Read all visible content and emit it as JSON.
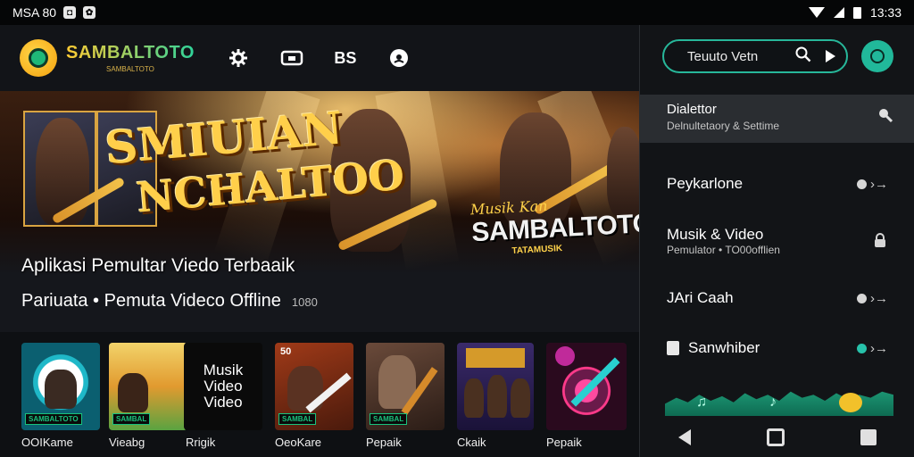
{
  "status_bar": {
    "carrier": "MSA 80",
    "time": "13:33"
  },
  "app_bar": {
    "brand_name": "SAMBALTOTO",
    "brand_tagline": "SAMBALTOTO",
    "nav_icons": [
      "gear-icon",
      "video-icon",
      "bs-icon",
      "podcast-icon"
    ],
    "nav_text_icon": "BS"
  },
  "hero": {
    "title_line1": "SMIUIAN",
    "title_line2": "NCHALTOO",
    "brand_script": "Musik Kan",
    "brand_word": "SAMBALTOTO",
    "brand_small": "TATAMUSIK",
    "caption_line1": "Aplikasi Pemultar Viedo Terbaaik",
    "caption_line2": "Pariuata • Pemuta Videco Offline",
    "caption_badge": "1080"
  },
  "thumbnails": [
    {
      "label": "OOIKame",
      "badge": "SAMBALTOTO"
    },
    {
      "label": "Vieabg",
      "badge": "SAMBAL"
    },
    {
      "label": "Rrigik",
      "text": "Musik Video Video"
    },
    {
      "label": "OeoKare",
      "badge": "SAMBAL",
      "top_text": "50"
    },
    {
      "label": "Pepaik",
      "badge": "SAMBAL"
    },
    {
      "label": "Ckaik",
      "badge": ""
    },
    {
      "label": "Pepaik",
      "badge": ""
    }
  ],
  "sidebar": {
    "search_placeholder": "Teuuto Vetn",
    "menu_first": {
      "title": "Dialettor",
      "sub": "Delnultetaory & Settime"
    },
    "menu_items": [
      {
        "label": "Peykarlone",
        "sub": ""
      },
      {
        "label": "Musik & Video",
        "sub": "Pemulator • TO00offlien"
      },
      {
        "label": "JAri Caah",
        "sub": ""
      },
      {
        "label": "Sanwhiber",
        "sub": ""
      }
    ]
  },
  "colors": {
    "accent": "#27b79a",
    "gold": "#ffcc33",
    "background": "#0b0d10"
  }
}
